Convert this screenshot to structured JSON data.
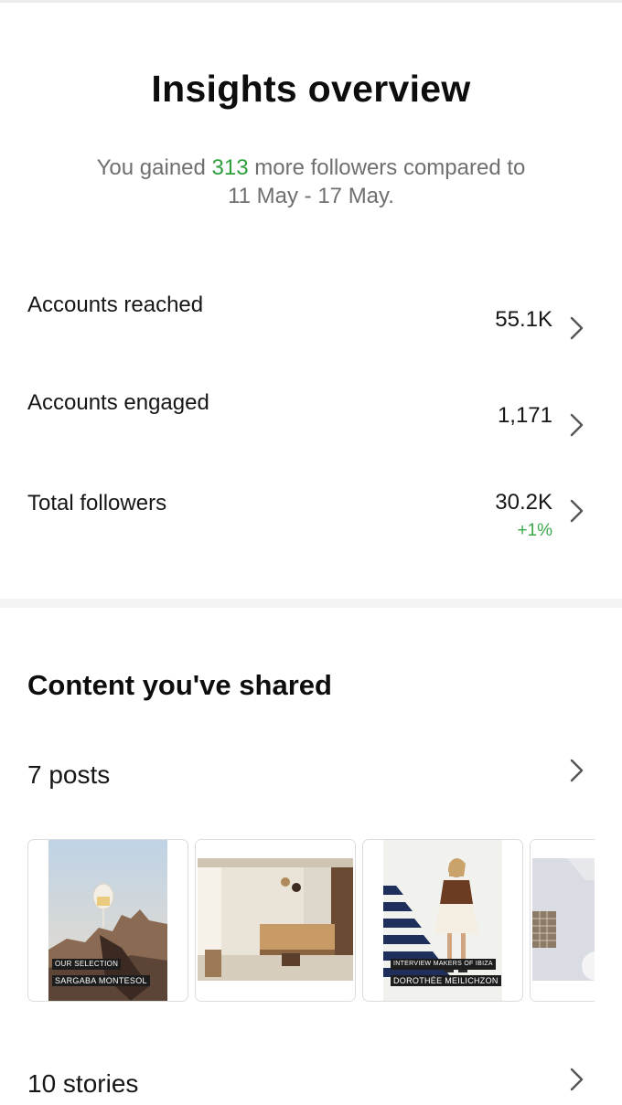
{
  "header": {
    "title": "Insights overview",
    "subtitle_prefix": "You gained ",
    "subtitle_highlight": "313",
    "subtitle_suffix": " more followers compared to",
    "subtitle_line2": "11 May - 17 May."
  },
  "metrics": [
    {
      "label": "Accounts reached",
      "value": "55.1K"
    },
    {
      "label": "Accounts engaged",
      "value": "1,171"
    },
    {
      "label": "Total followers",
      "value": "30.2K",
      "delta": "+1%"
    }
  ],
  "content": {
    "title": "Content you've shared",
    "posts_label": "7 posts",
    "stories_label": "10 stories",
    "thumbnails": [
      {
        "caption_line1": "OUR SELECTION",
        "caption_line2": "SARGABA MONTESOL"
      },
      {
        "caption_line1": "",
        "caption_line2": ""
      },
      {
        "caption_line1": "INTERVIEW MAKERS OF IBIZA",
        "caption_line2": "DOROTHÉE MEILICHZON"
      },
      {
        "caption_line1": "",
        "caption_line2": ""
      }
    ]
  },
  "colors": {
    "accent_green": "#2f9e3d",
    "delta_green": "#3aa84b",
    "muted_text": "#6f6f6f"
  },
  "icons": {
    "row_chevron": "chevron-right-icon"
  }
}
